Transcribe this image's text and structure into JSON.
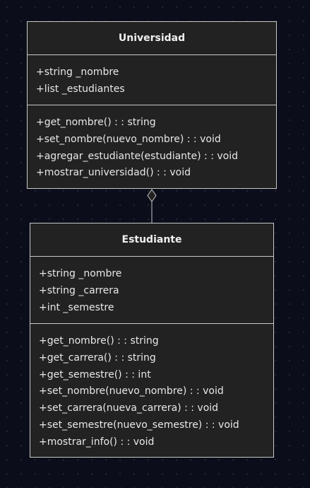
{
  "diagram": {
    "classes": [
      {
        "name": "Universidad",
        "attributes": [
          "+string _nombre",
          "+list _estudiantes"
        ],
        "methods": [
          "+get_nombre() : : string",
          "+set_nombre(nuevo_nombre) : : void",
          "+agregar_estudiante(estudiante) : : void",
          "+mostrar_universidad() : : void"
        ]
      },
      {
        "name": "Estudiante",
        "attributes": [
          "+string _nombre",
          "+string _carrera",
          "+int _semestre"
        ],
        "methods": [
          "+get_nombre() : : string",
          "+get_carrera() : : string",
          "+get_semestre() : : int",
          "+set_nombre(nuevo_nombre) : : void",
          "+set_carrera(nueva_carrera) : : void",
          "+set_semestre(nuevo_semestre) : : void",
          "+mostrar_info() : : void"
        ]
      }
    ],
    "relationships": [
      {
        "type": "aggregation",
        "whole": "Universidad",
        "part": "Estudiante"
      }
    ],
    "colors": {
      "background": "#0b0e1a",
      "box_fill": "#222222",
      "box_border": "#c8c8c8",
      "text": "#e8e8e8"
    }
  }
}
